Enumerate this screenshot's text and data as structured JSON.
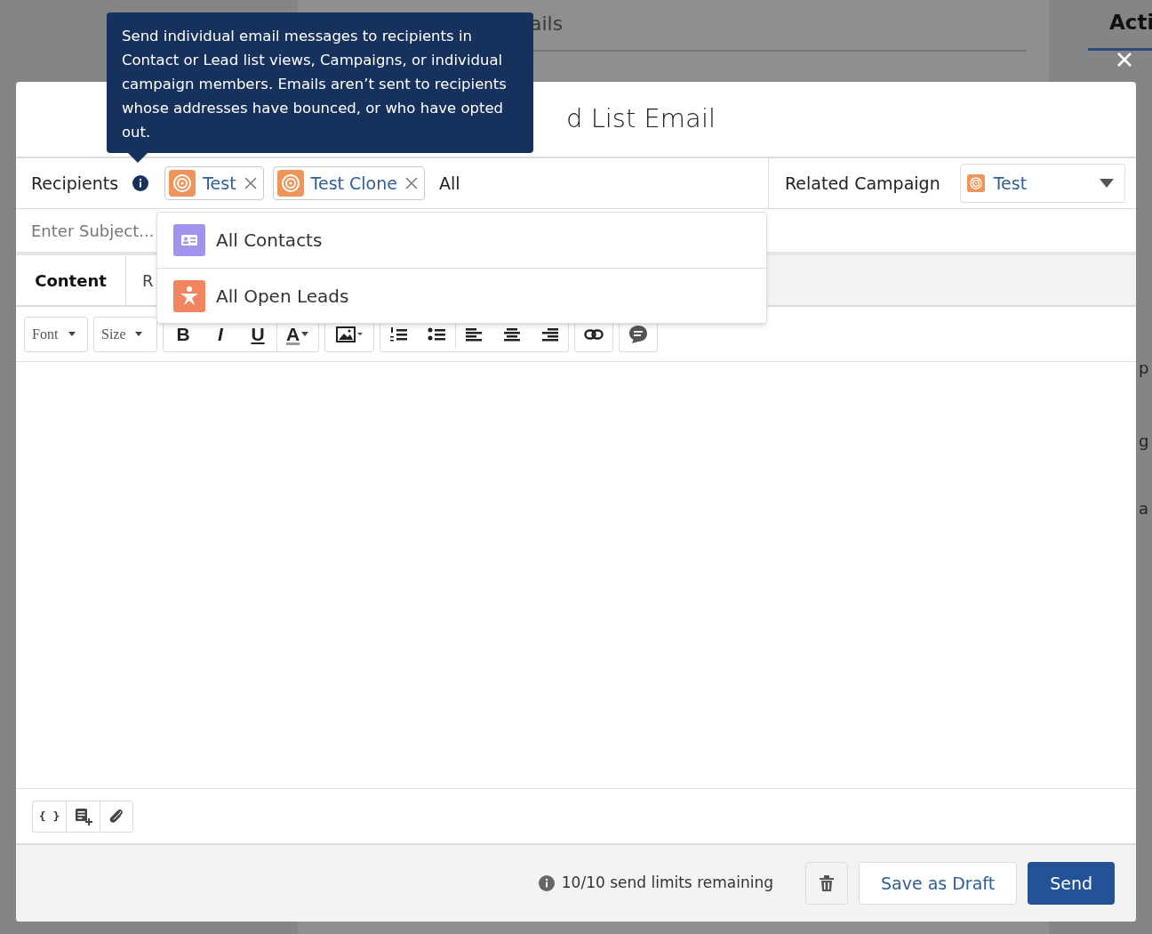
{
  "background_fragments": [
    {
      "text": "ails",
      "kind": "heading"
    },
    {
      "text": "Acti",
      "kind": "tab"
    },
    {
      "text": "p",
      "kind": "side"
    },
    {
      "text": "g",
      "kind": "side"
    },
    {
      "text": "a",
      "kind": "side"
    }
  ],
  "tooltip": {
    "text": "Send individual email messages to recipients in Contact or Lead list views, Campaigns, or individual campaign members. Emails aren’t sent to recipients whose addresses have bounced, or who have opted out."
  },
  "modal": {
    "title": "d List Email",
    "recipients": {
      "label": "Recipients",
      "pills": [
        {
          "label": "Test"
        },
        {
          "label": "Test Clone"
        }
      ],
      "value": "All"
    },
    "related_campaign": {
      "label": "Related Campaign",
      "value": "Test"
    },
    "subject": {
      "placeholder": "Enter Subject..."
    },
    "tabs": [
      {
        "label": "Content",
        "selected": true
      },
      {
        "label": "R",
        "selected": false
      }
    ],
    "suggestions": [
      {
        "label": "All Contacts",
        "kind": "contacts"
      },
      {
        "label": "All Open Leads",
        "kind": "leads"
      }
    ],
    "toolbar": {
      "font": "Font",
      "size": "Size",
      "style_buttons": [
        {
          "label": "B",
          "kind": "bold"
        },
        {
          "label": "I",
          "kind": "italic"
        },
        {
          "label": "U",
          "kind": "underline"
        }
      ],
      "color_button": "A"
    },
    "bottom_tools": {
      "merge_field": "{ }"
    },
    "footer": {
      "limits": "10/10 send limits remaining",
      "save_draft": "Save as Draft",
      "send": "Send"
    }
  }
}
